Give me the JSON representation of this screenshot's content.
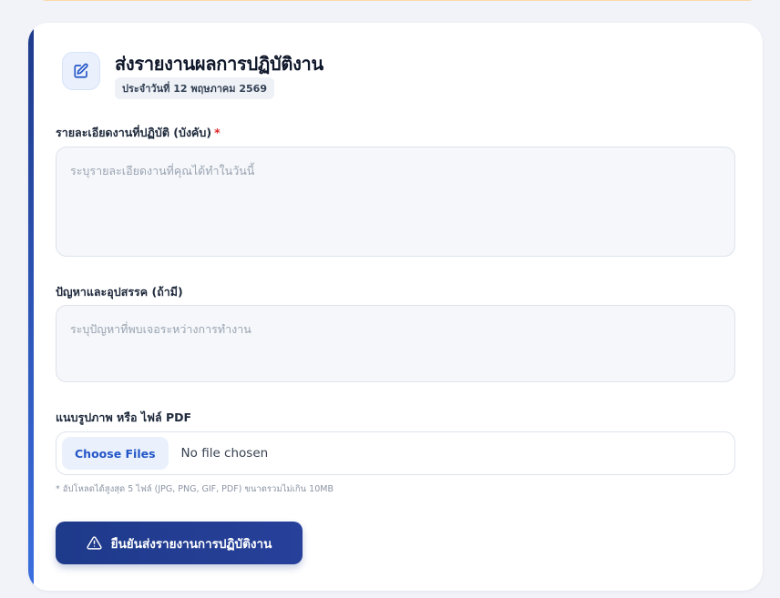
{
  "header": {
    "title": "ส่งรายงานผลการปฏิบัติงาน",
    "date_badge": "ประจำวันที่ 12 พฤษภาคม 2569",
    "icon": "edit-icon"
  },
  "form": {
    "details": {
      "label": "รายละเอียดงานที่ปฏิบัติ (บังคับ)",
      "required_mark": "*",
      "placeholder": "ระบุรายละเอียดงานที่คุณได้ทำในวันนี้",
      "value": ""
    },
    "issues": {
      "label": "ปัญหาและอุปสรรค (ถ้ามี)",
      "placeholder": "ระบุปัญหาที่พบเจอระหว่างการทำงาน",
      "value": ""
    },
    "attachment": {
      "label": "แนบรูปภาพ หรือ ไฟล์ PDF",
      "choose_label": "Choose Files",
      "status": "No file chosen",
      "hint": "* อัปโหลดได้สูงสุด 5 ไฟล์ (JPG, PNG, GIF, PDF) ขนาดรวมไม่เกิน 10MB"
    },
    "submit": {
      "label": "ยืนยันส่งรายงานการปฏิบัติงาน",
      "icon": "warning-icon"
    }
  },
  "colors": {
    "accent": "#1e3a8a",
    "required": "#dc2626",
    "choose_text": "#2456c7"
  }
}
